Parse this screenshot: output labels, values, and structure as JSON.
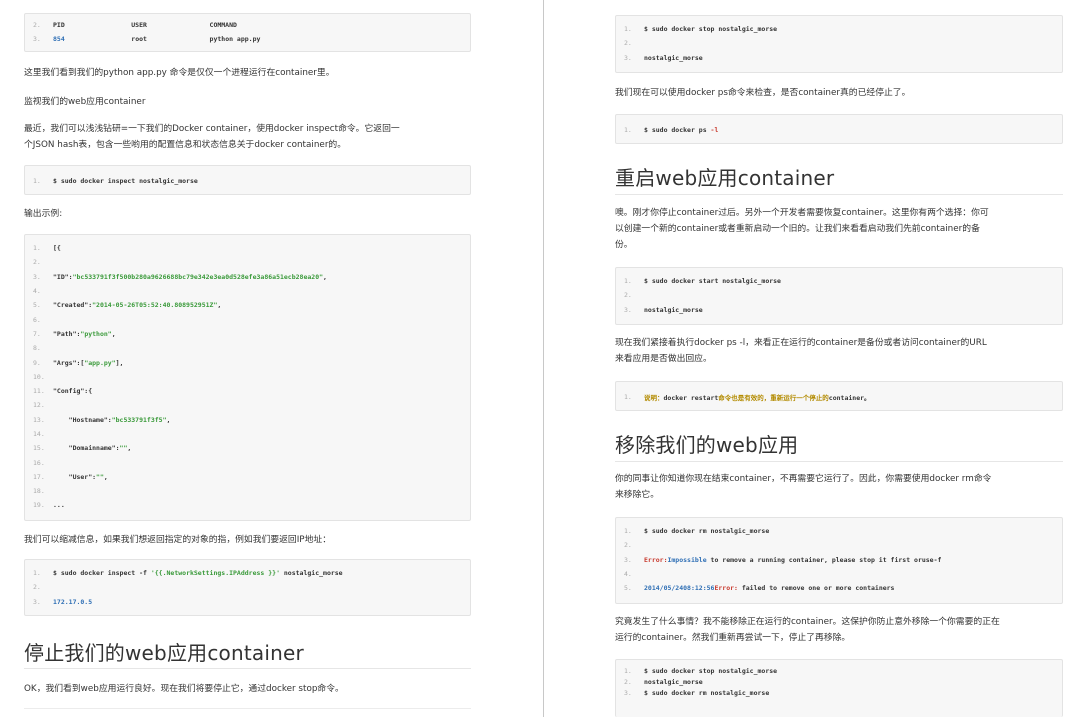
{
  "left": {
    "code_top": [
      {
        "n": "2.",
        "parts": [
          {
            "t": "PID                 USER                COMMAND",
            "c": ""
          }
        ]
      },
      {
        "n": "3.",
        "parts": [
          {
            "t": "854",
            "c": "b"
          },
          {
            "t": "                 root                python app.py",
            "c": ""
          }
        ]
      }
    ],
    "p1": "这里我们看到我们的python app.py 命令是仅仅一个进程运行在container里。",
    "p2": "监视我们的web应用container",
    "p3a": "最近，我们可以浅浅钻研=一下我们的Docker container，使用docker inspect命令。它返回一",
    "p3b": "个JSON hash表，包含一些哟用的配置信息和状态信息关于docker container的。",
    "code_inspect": [
      {
        "n": "1.",
        "parts": [
          {
            "t": "$ sudo docker inspect nostalgic_morse",
            "c": ""
          }
        ]
      }
    ],
    "p4": "输出示例:",
    "code_json": [
      {
        "n": "1.",
        "parts": [
          {
            "t": "[{",
            "c": ""
          }
        ]
      },
      {
        "n": "2.",
        "parts": []
      },
      {
        "n": "3.",
        "parts": [
          {
            "t": "\"ID\":",
            "c": ""
          },
          {
            "t": "\"bc533791f3f500b280a9626688bc79e342e3ea0d528efe3a86a51ecb28ea20\"",
            "c": "g"
          },
          {
            "t": ",",
            "c": ""
          }
        ]
      },
      {
        "n": "4.",
        "parts": []
      },
      {
        "n": "5.",
        "parts": [
          {
            "t": "\"Created\":",
            "c": ""
          },
          {
            "t": "\"2014-05-26T05:52:40.808952951Z\"",
            "c": "g"
          },
          {
            "t": ",",
            "c": ""
          }
        ]
      },
      {
        "n": "6.",
        "parts": []
      },
      {
        "n": "7.",
        "parts": [
          {
            "t": "\"Path\":",
            "c": ""
          },
          {
            "t": "\"python\"",
            "c": "g"
          },
          {
            "t": ",",
            "c": ""
          }
        ]
      },
      {
        "n": "8.",
        "parts": []
      },
      {
        "n": "9.",
        "parts": [
          {
            "t": "\"Args\":[",
            "c": ""
          },
          {
            "t": "\"app.py\"",
            "c": "g"
          },
          {
            "t": "],",
            "c": ""
          }
        ]
      },
      {
        "n": "10.",
        "parts": []
      },
      {
        "n": "11.",
        "parts": [
          {
            "t": "\"Config\":{",
            "c": ""
          }
        ]
      },
      {
        "n": "12.",
        "parts": []
      },
      {
        "n": "13.",
        "parts": [
          {
            "t": "    \"Hostname\":",
            "c": ""
          },
          {
            "t": "\"bc533791f3f5\"",
            "c": "g"
          },
          {
            "t": ",",
            "c": ""
          }
        ]
      },
      {
        "n": "14.",
        "parts": []
      },
      {
        "n": "15.",
        "parts": [
          {
            "t": "    \"Domainname\":",
            "c": ""
          },
          {
            "t": "\"\"",
            "c": "g"
          },
          {
            "t": ",",
            "c": ""
          }
        ]
      },
      {
        "n": "16.",
        "parts": []
      },
      {
        "n": "17.",
        "parts": [
          {
            "t": "    \"User\":",
            "c": ""
          },
          {
            "t": "\"\"",
            "c": "g"
          },
          {
            "t": ",",
            "c": ""
          }
        ]
      },
      {
        "n": "18.",
        "parts": []
      },
      {
        "n": "19.",
        "parts": [
          {
            "t": "...",
            "c": ""
          }
        ]
      }
    ],
    "p5": "我们可以缩减信息，如果我们想返回指定的对象的指，例如我们要返回IP地址：",
    "code_ip": [
      {
        "n": "1.",
        "parts": [
          {
            "t": "$ sudo docker inspect -f ",
            "c": ""
          },
          {
            "t": "'{{.NetworkSettings.IPAddress }}'",
            "c": "g"
          },
          {
            "t": " nostalgic_morse",
            "c": ""
          }
        ]
      },
      {
        "n": "2.",
        "parts": []
      },
      {
        "n": "3.",
        "parts": [
          {
            "t": "172.17.0.5",
            "c": "b"
          }
        ]
      }
    ],
    "h1": "停止我们的web应用container",
    "p6": "OK，我们看到web应用运行良好。现在我们将要停止它，通过docker stop命令。"
  },
  "right": {
    "code_stop": [
      {
        "n": "1.",
        "parts": [
          {
            "t": "$ sudo docker stop nostalgic_morse",
            "c": ""
          }
        ]
      },
      {
        "n": "2.",
        "parts": []
      },
      {
        "n": "3.",
        "parts": [
          {
            "t": "nostalgic_morse",
            "c": ""
          }
        ]
      }
    ],
    "p1": "我们现在可以使用docker ps命令来检查，是否container真的已经停止了。",
    "code_ps": [
      {
        "n": "1.",
        "parts": [
          {
            "t": "$ sudo docker ps ",
            "c": ""
          },
          {
            "t": "-l",
            "c": "r"
          }
        ]
      }
    ],
    "h1": "重启web应用container",
    "p2a": "噢。刚才你停止container过后。另外一个开发者需要恢复container。这里你有两个选择：你可",
    "p2b": "以创建一个新的container或者重新启动一个旧的。让我们来看看启动我们先前container的备",
    "p2c": "份。",
    "code_start": [
      {
        "n": "1.",
        "parts": [
          {
            "t": "$ sudo docker start nostalgic_morse",
            "c": ""
          }
        ]
      },
      {
        "n": "2.",
        "parts": []
      },
      {
        "n": "3.",
        "parts": [
          {
            "t": "nostalgic_morse",
            "c": ""
          }
        ]
      }
    ],
    "p3a": "现在我们紧接着执行docker ps -l，来看正在运行的container是备份或者访问container的URL",
    "p3b": "来看应用是否做出回应。",
    "code_note": [
      {
        "n": "1.",
        "parts": [
          {
            "t": "说明：",
            "c": "o"
          },
          {
            "t": "docker restart",
            "c": ""
          },
          {
            "t": "命令也是有效的，重新运行一个停止的",
            "c": "o"
          },
          {
            "t": "container。",
            "c": ""
          }
        ]
      }
    ],
    "h2": "移除我们的web应用",
    "p4a": "你的同事让你知道你现在结束container，不再需要它运行了。因此，你需要使用docker rm命令",
    "p4b": "来移除它。",
    "code_rm": [
      {
        "n": "1.",
        "parts": [
          {
            "t": "$ sudo docker rm nostalgic_morse",
            "c": ""
          }
        ]
      },
      {
        "n": "2.",
        "parts": []
      },
      {
        "n": "3.",
        "parts": [
          {
            "t": "Error:",
            "c": "r"
          },
          {
            "t": "Impossible",
            "c": "b"
          },
          {
            "t": " to remove a running container, please stop it first oruse-f",
            "c": ""
          }
        ]
      },
      {
        "n": "4.",
        "parts": []
      },
      {
        "n": "5.",
        "parts": [
          {
            "t": "2014/05/2408:12:56",
            "c": "b"
          },
          {
            "t": "Error:",
            "c": "r"
          },
          {
            "t": " failed to remove one or more containers",
            "c": ""
          }
        ]
      }
    ],
    "p5a": "究竟发生了什么事情？我不能移除正在运行的container。这保护你防止意外移除一个你需要的正在",
    "p5b": "运行的container。然我们重新再尝试一下，停止了再移除。",
    "code_final": [
      {
        "n": "1.",
        "parts": [
          {
            "t": "$ sudo docker stop nostalgic_morse",
            "c": ""
          }
        ]
      },
      {
        "n": "2.",
        "parts": [
          {
            "t": "nostalgic_morse",
            "c": ""
          }
        ]
      },
      {
        "n": "3.",
        "parts": [
          {
            "t": "$ sudo docker rm nostalgic_morse",
            "c": ""
          }
        ]
      }
    ]
  }
}
